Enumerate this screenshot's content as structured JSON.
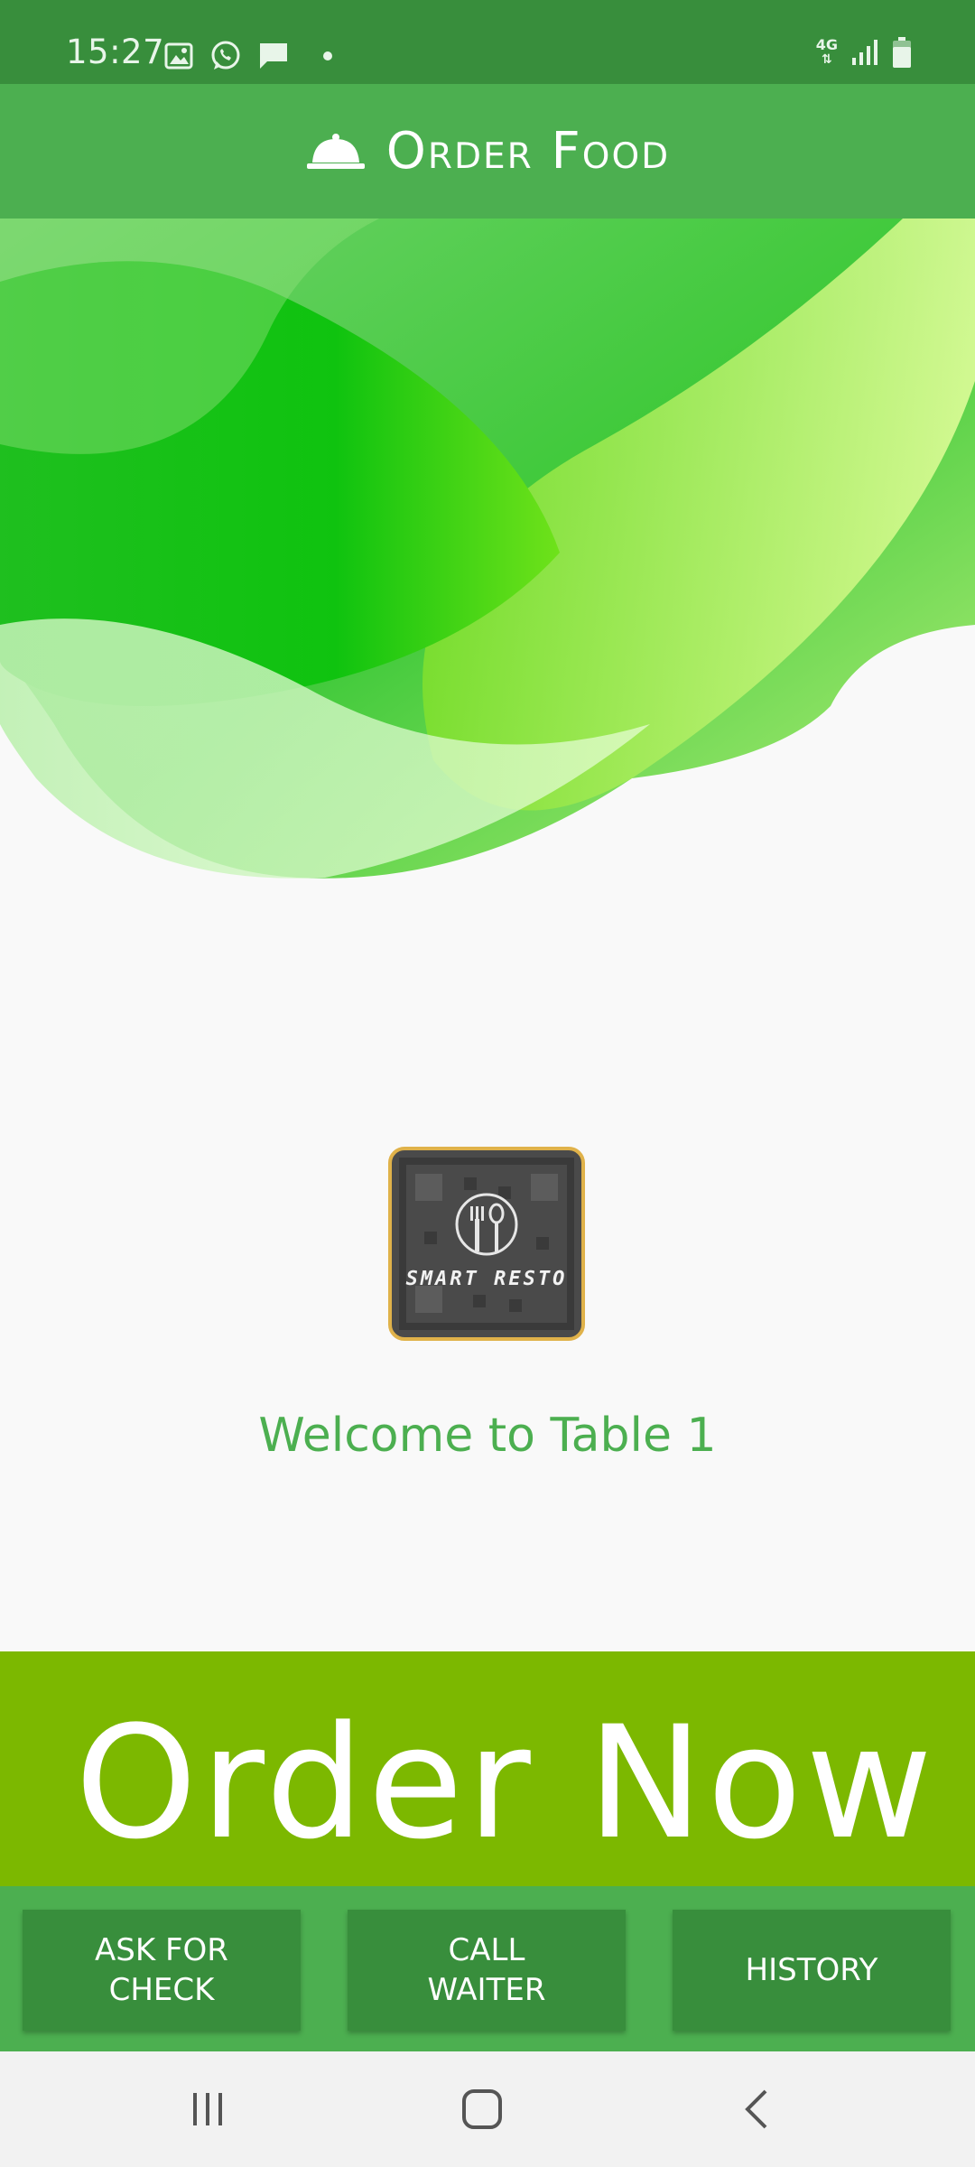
{
  "status_bar": {
    "time": "15:27",
    "network": "4G",
    "icons": [
      "image-icon",
      "whatsapp-icon",
      "message-icon",
      "dot-icon",
      "signal-icon",
      "battery-icon"
    ]
  },
  "app_bar": {
    "icon": "cloche-icon",
    "title": "Order Food"
  },
  "logo": {
    "text": "SMART RESTO"
  },
  "welcome_text": "Welcome to Table 1",
  "order_button": "Order Now",
  "bottom_buttons": {
    "ask_check": "ASK FOR\nCHECK",
    "call_waiter": "CALL\nWAITER",
    "history": "HISTORY"
  },
  "colors": {
    "status_bar": "#388e3c",
    "app_bar": "#4caf50",
    "accent": "#7cb800",
    "button": "#388e3c"
  }
}
